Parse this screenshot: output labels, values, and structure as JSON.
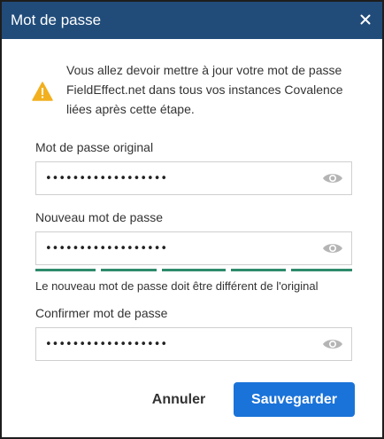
{
  "dialog": {
    "title": "Mot de passe",
    "close_icon": "close-icon"
  },
  "warning": {
    "icon": "warning-triangle-icon",
    "color": "#f2b01e",
    "message": "Vous allez devoir mettre à jour votre mot de passe FieldEffect.net dans tous vos instances Covalence liées après cette étape."
  },
  "fields": {
    "original": {
      "label": "Mot de passe original",
      "value": "••••••••••••••••••",
      "icon": "eye-icon"
    },
    "new": {
      "label": "Nouveau mot de passe",
      "value": "••••••••••••••••••",
      "icon": "eye-icon",
      "strength_segments_filled": 5,
      "strength_segments_total": 5,
      "strength_color": "#2e8b6b",
      "hint": "Le nouveau mot de passe doit être différent de l'original"
    },
    "confirm": {
      "label": "Confirmer mot de passe",
      "value": "••••••••••••••••••",
      "icon": "eye-icon"
    }
  },
  "buttons": {
    "cancel": "Annuler",
    "save": "Sauvegarder"
  },
  "colors": {
    "titlebar": "#214c7a",
    "primary": "#1a73d9"
  }
}
